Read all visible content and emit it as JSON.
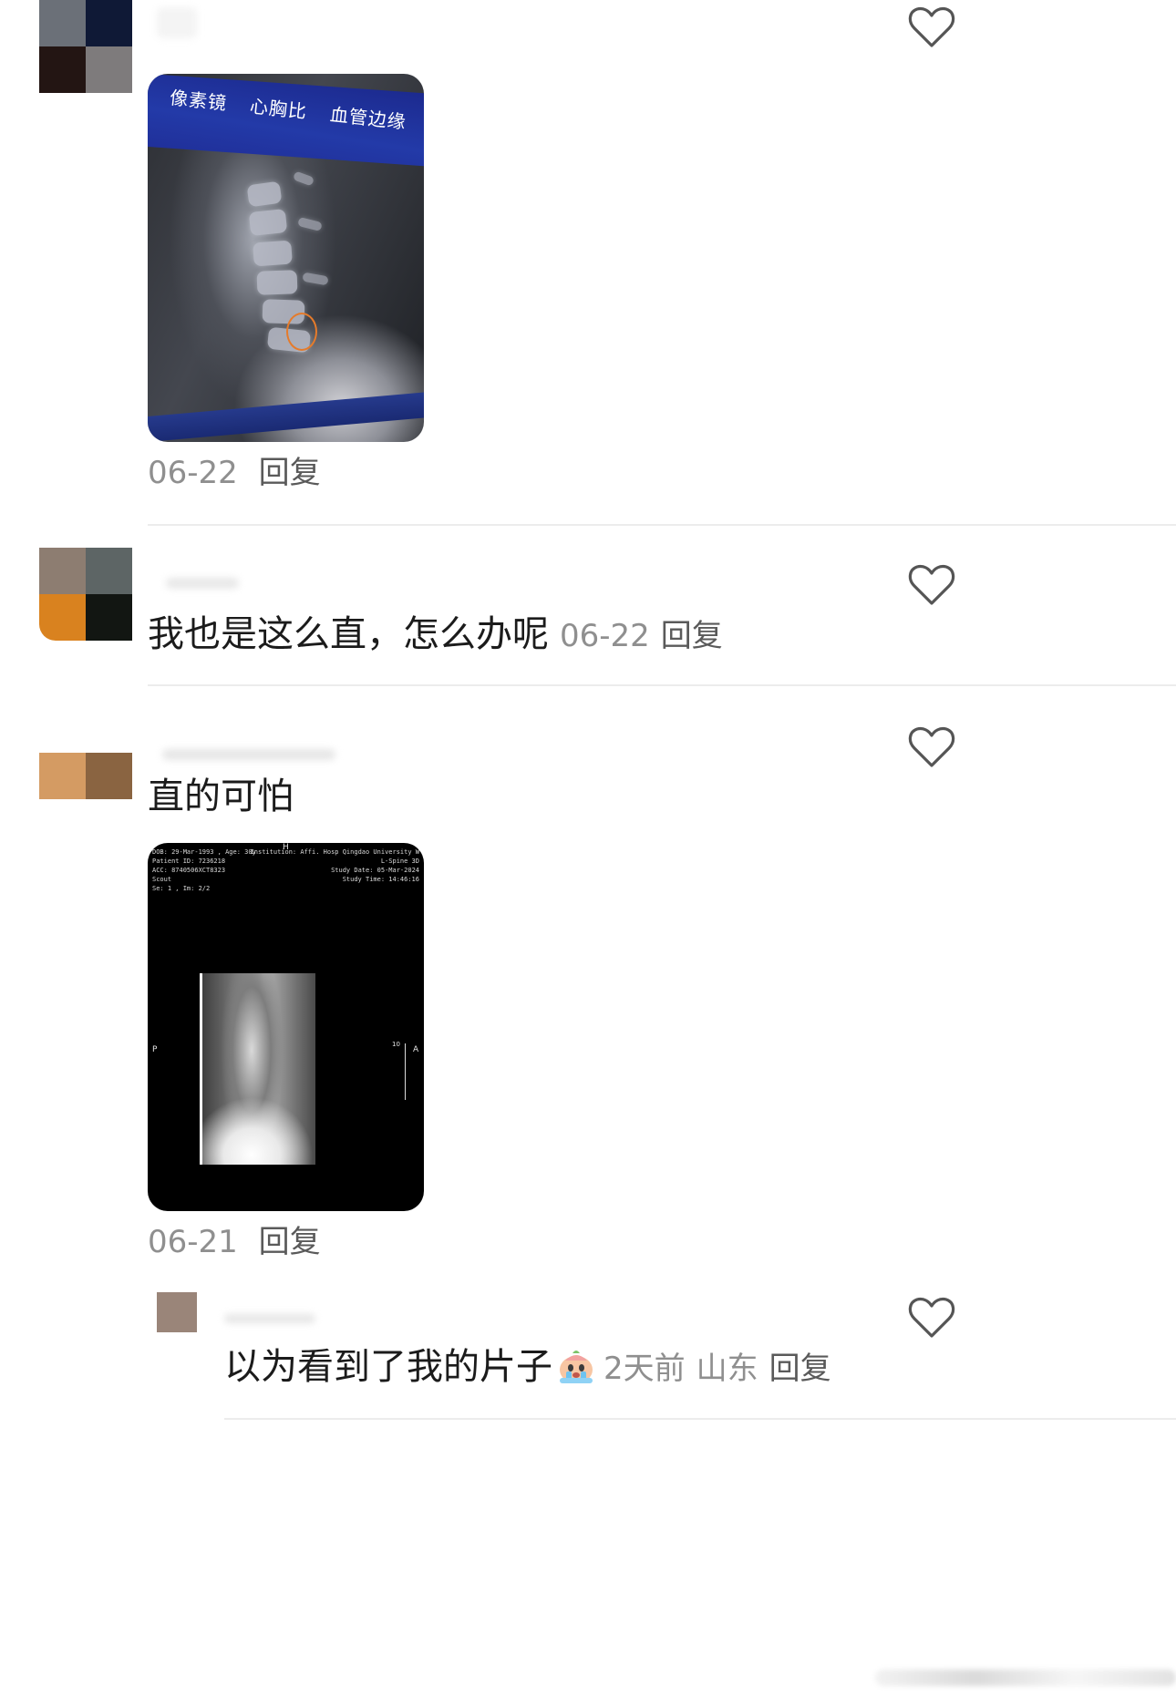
{
  "comments": [
    {
      "id": "c1",
      "avatar_colors": [
        "#6b7078",
        "#0f1936",
        "#231513",
        "#7e7b7c"
      ],
      "image": {
        "toolbar_labels": [
          "像素镜",
          "心胸比",
          "血管边缘"
        ]
      },
      "date": "06-22",
      "reply_label": "回复"
    },
    {
      "id": "c2",
      "avatar_colors": [
        "#8d7d71",
        "#5d6565",
        "#d9821f",
        "#121612"
      ],
      "text": "我也是这么直，怎么办呢",
      "date": "06-22",
      "reply_label": "回复"
    },
    {
      "id": "c3",
      "avatar_colors": [
        "#ffffff",
        "#ffffff",
        "#d49b63",
        "#8a6441"
      ],
      "text": "直的可怕",
      "image": {
        "header_left": [
          "DOB: 29-Mar-1993 , Age: 30y",
          "Patient ID: 7236218",
          "ACC: 8740506XCT8323",
          "Scout",
          "Se: 1 , Im: 2/2"
        ],
        "header_right": [
          "Institution: Affi. Hosp Qingdao University W",
          "L-Spine 3D",
          "Study Date: 05-Mar-2024",
          "Study Time: 14:46:16"
        ],
        "marker_top": "H",
        "marker_left": "P",
        "marker_right": "A",
        "ruler_label": "10"
      },
      "date": "06-21",
      "reply_label": "回复"
    },
    {
      "id": "r1",
      "text": "以为看到了我的片子",
      "time": "2天前",
      "location": "山东",
      "reply_label": "回复"
    }
  ],
  "icons": {
    "like": "heart-outline-icon",
    "emoji": "crying-face-emoji-icon"
  }
}
